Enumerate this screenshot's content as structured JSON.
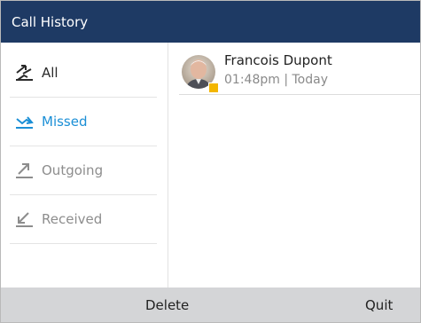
{
  "header": {
    "title": "Call History"
  },
  "sidebar": {
    "filters": [
      {
        "label": "All",
        "icon": "all-calls-icon"
      },
      {
        "label": "Missed",
        "icon": "missed-call-icon"
      },
      {
        "label": "Outgoing",
        "icon": "outgoing-call-icon"
      },
      {
        "label": "Received",
        "icon": "received-call-icon"
      }
    ]
  },
  "calls": [
    {
      "name": "Francois Dupont",
      "time": "01:48pm | Today",
      "presence_color": "#f3b600",
      "avatar_icon": "contact-avatar"
    }
  ],
  "softkeys": {
    "delete_label": "Delete",
    "quit_label": "Quit"
  },
  "colors": {
    "header": "#1e3a64",
    "accent": "#1b8fd6",
    "softbar": "#d4d5d7"
  }
}
